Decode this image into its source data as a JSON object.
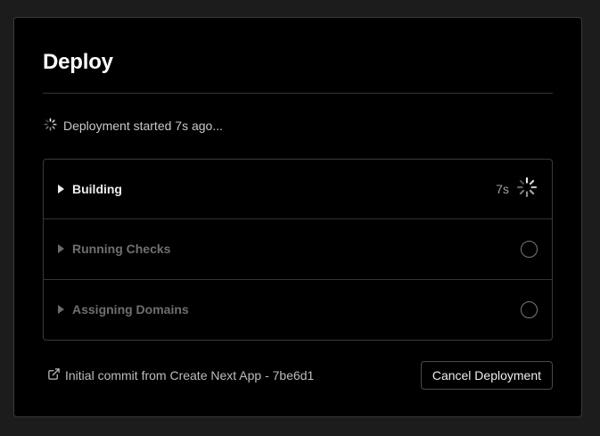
{
  "dialog": {
    "title": "Deploy",
    "status_text": "Deployment started 7s ago...",
    "status_icon": "spinner-icon"
  },
  "steps": [
    {
      "label": "Building",
      "elapsed": "7s",
      "state": "in-progress",
      "icon": "spinner-icon"
    },
    {
      "label": "Running Checks",
      "state": "pending",
      "icon": "pending-circle-icon"
    },
    {
      "label": "Assigning Domains",
      "state": "pending",
      "icon": "pending-circle-icon"
    }
  ],
  "footer": {
    "commit_text": "Initial commit from Create Next App - 7be6d1",
    "link_icon": "external-link-icon",
    "cancel_label": "Cancel Deployment"
  },
  "colors": {
    "background": "#000000",
    "border": "#3a3a3a",
    "text": "#ededed",
    "muted": "#6f6f6f"
  }
}
